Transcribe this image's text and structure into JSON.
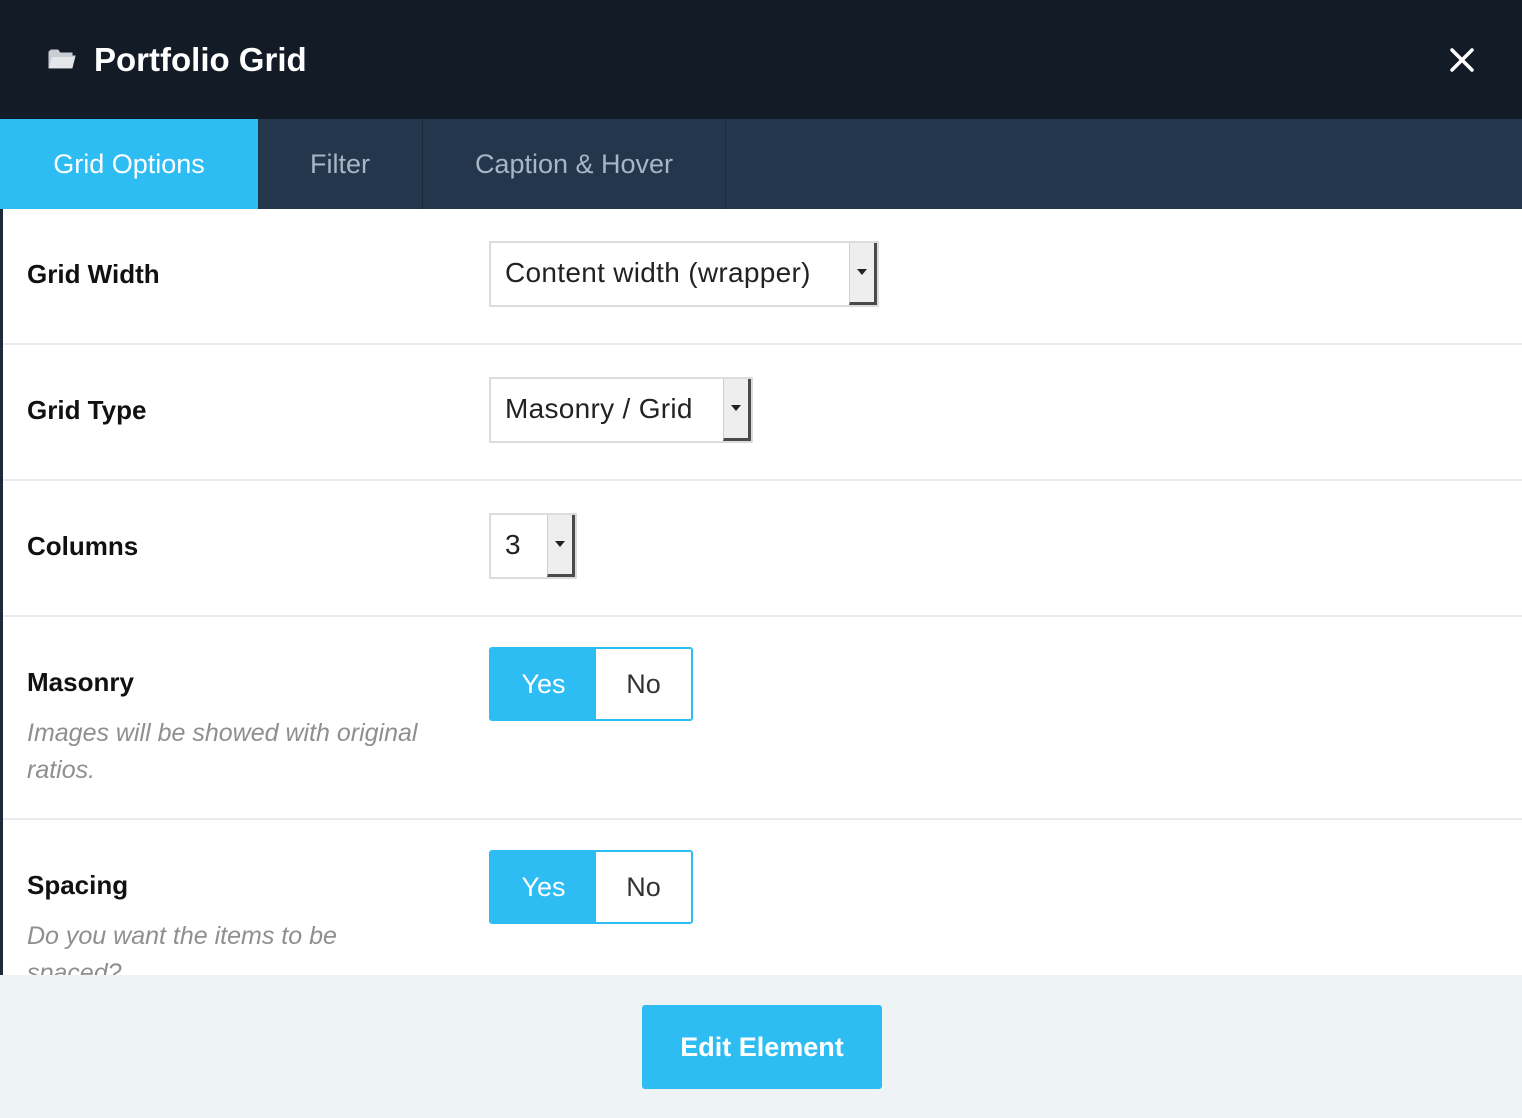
{
  "header": {
    "title": "Portfolio Grid",
    "folder_icon": "folder-icon",
    "close_icon": "close-icon"
  },
  "tabs": [
    {
      "label": "Grid Options",
      "active": true
    },
    {
      "label": "Filter",
      "active": false
    },
    {
      "label": "Caption & Hover",
      "active": false
    }
  ],
  "fields": {
    "grid_width": {
      "label": "Grid Width",
      "value": "Content width (wrapper)"
    },
    "grid_type": {
      "label": "Grid Type",
      "value": "Masonry / Grid"
    },
    "columns": {
      "label": "Columns",
      "value": "3"
    },
    "masonry": {
      "label": "Masonry",
      "description": "Images will be showed with original ratios.",
      "yes_label": "Yes",
      "no_label": "No",
      "selected": "Yes"
    },
    "spacing": {
      "label": "Spacing",
      "description": "Do you want the items to be spaced?",
      "yes_label": "Yes",
      "no_label": "No",
      "selected": "Yes"
    }
  },
  "footer": {
    "edit_label": "Edit Element"
  },
  "colors": {
    "accent": "#2dbdf3",
    "header_bg": "#131b26",
    "tabs_bg": "#23364c",
    "footer_bg": "#eef3f6"
  }
}
